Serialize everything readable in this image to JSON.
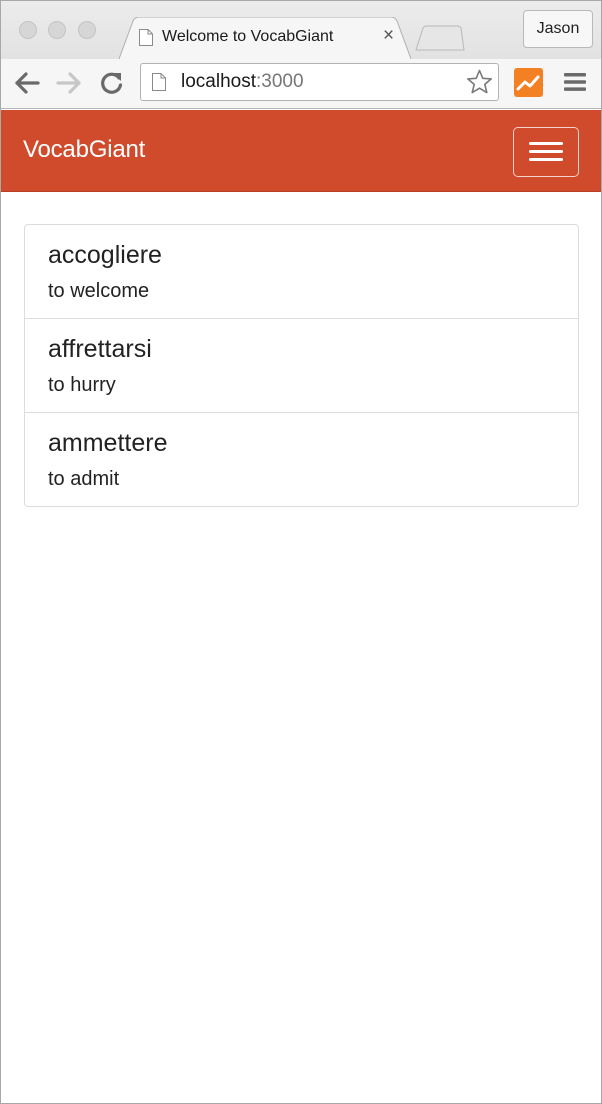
{
  "browser": {
    "tab_title": "Welcome to VocabGiant",
    "tab_close": "×",
    "profile_name": "Jason",
    "url_host": "localhost",
    "url_port": ":3000",
    "icons": {
      "back": "arrow-left-icon",
      "forward": "arrow-right-icon",
      "reload": "reload-icon",
      "page": "page-icon",
      "bookmark": "star-icon",
      "extension": "analytics-extension-icon",
      "menu": "hamburger-menu-icon"
    }
  },
  "app": {
    "brand": "VocabGiant",
    "brand_color": "#d04b2c"
  },
  "words": [
    {
      "term": "accogliere",
      "definition": "to welcome"
    },
    {
      "term": "affrettarsi",
      "definition": "to hurry"
    },
    {
      "term": "ammettere",
      "definition": "to admit"
    }
  ]
}
